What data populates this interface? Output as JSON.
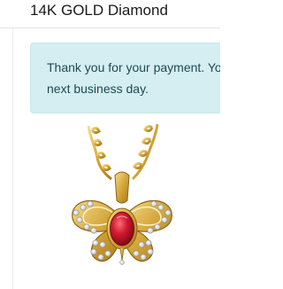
{
  "product": {
    "title": "14K GOLD Diamond"
  },
  "alert": {
    "line1": "Thank you for your payment. Yo",
    "line2": "next business day."
  },
  "colors": {
    "alert_background": "#d5eef1",
    "alert_text": "#1c4a55",
    "gold": "#d9b24a",
    "ruby": "#c0152a",
    "diamond": "#eeeeee"
  },
  "icons": {
    "product_image": "butterfly-pendant-icon"
  }
}
